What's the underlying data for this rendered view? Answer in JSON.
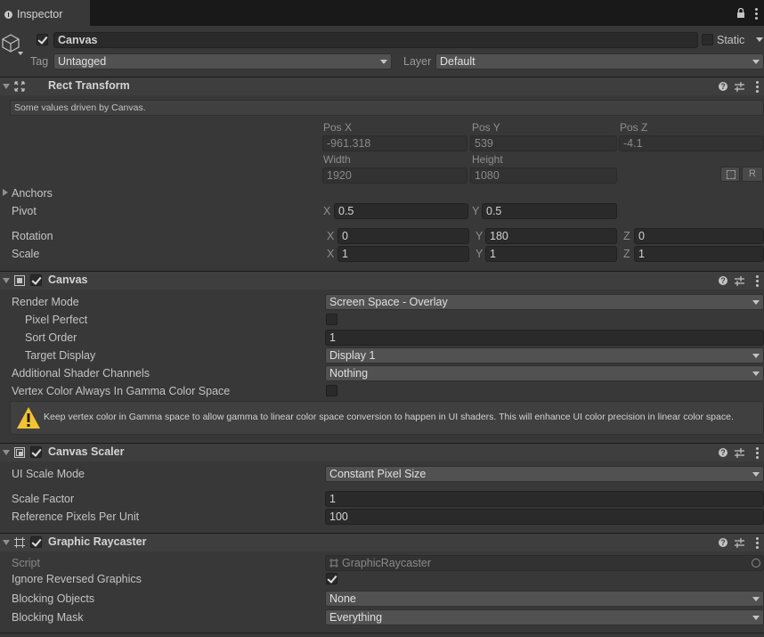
{
  "tab": {
    "title": "Inspector"
  },
  "object": {
    "name": "Canvas",
    "static_label": "Static",
    "tag_label": "Tag",
    "tag_value": "Untagged",
    "layer_label": "Layer",
    "layer_value": "Default"
  },
  "rect_transform": {
    "title": "Rect Transform",
    "driven_note": "Some values driven by Canvas.",
    "pos_x_label": "Pos X",
    "pos_y_label": "Pos Y",
    "pos_z_label": "Pos Z",
    "pos_x": "-961.318",
    "pos_y": "539",
    "pos_z": "-4.1",
    "width_label": "Width",
    "height_label": "Height",
    "width": "1920",
    "height": "1080",
    "raw_button": "R",
    "anchors_label": "Anchors",
    "pivot_label": "Pivot",
    "pivot_x": "0.5",
    "pivot_y": "0.5",
    "rotation_label": "Rotation",
    "rot_x": "0",
    "rot_y": "180",
    "rot_z": "0",
    "scale_label": "Scale",
    "scale_x": "1",
    "scale_y": "1",
    "scale_z": "1",
    "axis_x": "X",
    "axis_y": "Y",
    "axis_z": "Z"
  },
  "canvas": {
    "title": "Canvas",
    "render_mode_label": "Render Mode",
    "render_mode": "Screen Space - Overlay",
    "pixel_perfect_label": "Pixel Perfect",
    "sort_order_label": "Sort Order",
    "sort_order": "1",
    "target_display_label": "Target Display",
    "target_display": "Display 1",
    "shader_channels_label": "Additional Shader Channels",
    "shader_channels": "Nothing",
    "vertex_color_label": "Vertex Color Always In Gamma Color Space",
    "warning": "Keep vertex color in Gamma space to allow gamma to linear color space conversion to happen in UI shaders. This will enhance UI color precision in linear color space."
  },
  "canvas_scaler": {
    "title": "Canvas Scaler",
    "ui_scale_mode_label": "UI Scale Mode",
    "ui_scale_mode": "Constant Pixel Size",
    "scale_factor_label": "Scale Factor",
    "scale_factor": "1",
    "ref_pixels_label": "Reference Pixels Per Unit",
    "ref_pixels": "100"
  },
  "graphic_raycaster": {
    "title": "Graphic Raycaster",
    "script_label": "Script",
    "script_value": "GraphicRaycaster",
    "ignore_reversed_label": "Ignore Reversed Graphics",
    "blocking_objects_label": "Blocking Objects",
    "blocking_objects": "None",
    "blocking_mask_label": "Blocking Mask",
    "blocking_mask": "Everything"
  },
  "colors": {
    "panel": "#383838",
    "header": "#3e3e3e",
    "field": "#2a2a2a",
    "dropdown": "#515151",
    "warning": "#f4c430"
  }
}
